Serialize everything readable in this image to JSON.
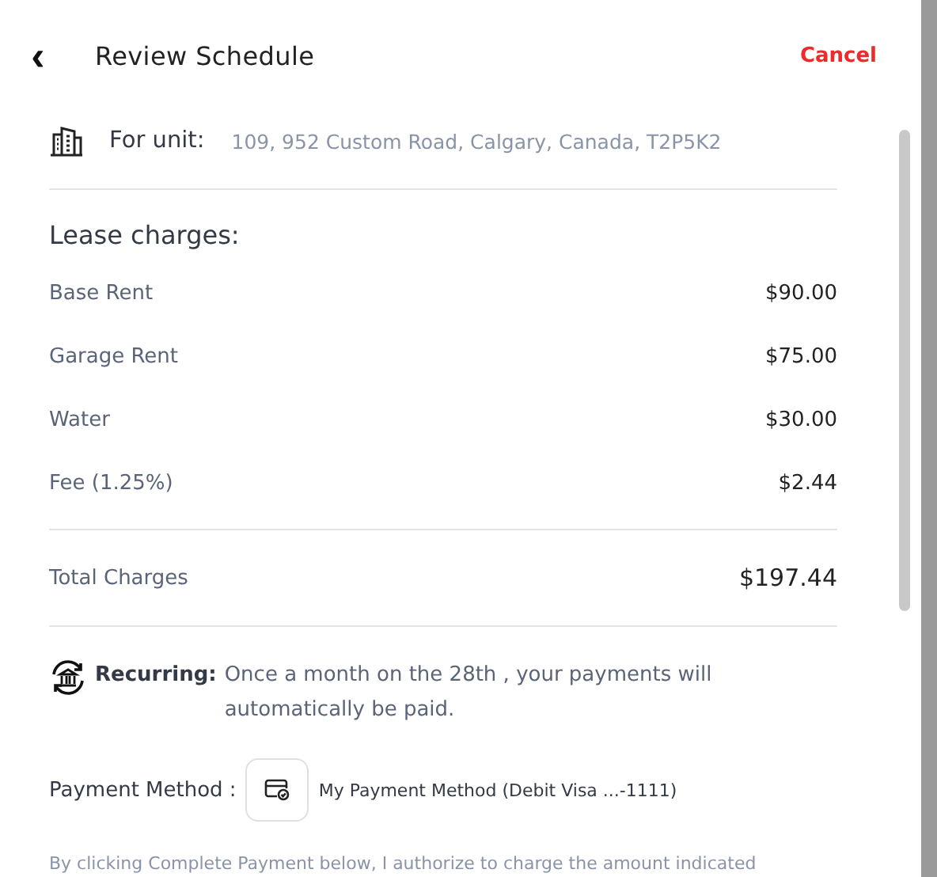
{
  "header": {
    "back": "‹",
    "title": "Review Schedule",
    "cancel": "Cancel"
  },
  "unit": {
    "label": "For unit:",
    "address": "109, 952 Custom Road, Calgary, Canada, T2P5K2"
  },
  "lease": {
    "title": "Lease charges:",
    "items": [
      {
        "name": "Base Rent",
        "amount": "$90.00"
      },
      {
        "name": "Garage Rent",
        "amount": "$75.00"
      },
      {
        "name": "Water",
        "amount": "$30.00"
      },
      {
        "name": "Fee (1.25%)",
        "amount": "$2.44"
      }
    ],
    "total": {
      "name": "Total Charges",
      "amount": "$197.44"
    }
  },
  "recurring": {
    "label": "Recurring:",
    "text": "Once a month on the 28th , your payments will automatically be paid."
  },
  "payment": {
    "label": "Payment Method :",
    "method": "My Payment Method (Debit Visa ...-1111)"
  },
  "disclaimer": "By clicking Complete Payment below, I authorize to charge the amount indicated"
}
